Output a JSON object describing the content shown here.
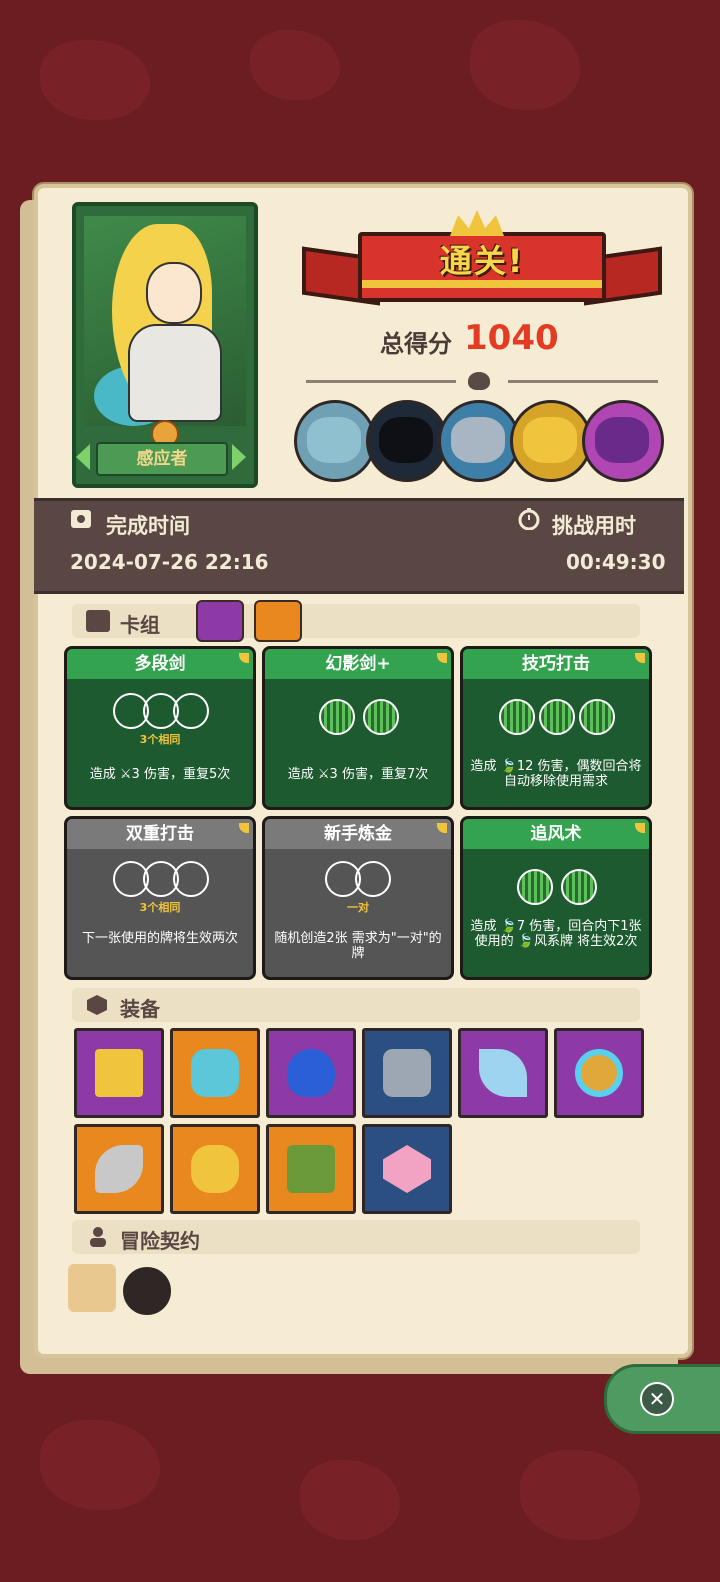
{
  "banner": {
    "title": "通关!"
  },
  "score": {
    "label": "总得分",
    "value": "1040"
  },
  "hero": {
    "name": "感应者"
  },
  "completion": {
    "label": "完成时间",
    "value": "2024-07-26 22:16"
  },
  "duration": {
    "label": "挑战用时",
    "value": "00:49:30"
  },
  "deck": {
    "title": "卡组",
    "cards": [
      {
        "name": "多段剑",
        "color": "green",
        "slots": 3,
        "filled": 0,
        "requirement": "3个相同",
        "desc": "造成 ⚔3 伤害，重复5次"
      },
      {
        "name": "幻影剑+",
        "color": "green",
        "slots": 2,
        "filled": 2,
        "requirement": "",
        "desc": "造成 ⚔3 伤害，重复7次"
      },
      {
        "name": "技巧打击",
        "color": "green",
        "slots": 3,
        "filled": 3,
        "requirement": "",
        "desc": "造成 🍃12 伤害，偶数回合将自动移除使用需求"
      },
      {
        "name": "双重打击",
        "color": "gray",
        "slots": 3,
        "filled": 0,
        "requirement": "3个相同",
        "desc": "下一张使用的牌将生效两次"
      },
      {
        "name": "新手炼金",
        "color": "gray",
        "slots": 2,
        "filled": 0,
        "requirement": "一对",
        "desc": "随机创造2张 需求为\"一对\"的牌"
      },
      {
        "name": "追风术",
        "color": "green",
        "slots": 2,
        "filled": 2,
        "requirement": "",
        "desc": "造成 🍃7 伤害，回合内下1张使用的 🍃风系牌 将生效2次"
      }
    ]
  },
  "equipment": {
    "title": "装备",
    "items": [
      {
        "icon": "gold-bars-icon",
        "bg": "purple"
      },
      {
        "icon": "crystal-shield-icon",
        "bg": "orange"
      },
      {
        "icon": "blue-flame-icon",
        "bg": "purple"
      },
      {
        "icon": "gauntlet-icon",
        "bg": "blue"
      },
      {
        "icon": "blade-hook-icon",
        "bg": "purple"
      },
      {
        "icon": "gem-ring-icon",
        "bg": "purple"
      },
      {
        "icon": "horn-icon",
        "bg": "orange"
      },
      {
        "icon": "golden-mask-icon",
        "bg": "orange"
      },
      {
        "icon": "moss-tablet-icon",
        "bg": "orange"
      },
      {
        "icon": "pink-dice-icon",
        "bg": "blue"
      }
    ]
  },
  "contract": {
    "title": "冒险契约"
  },
  "colors": {
    "accent": "#e23c24",
    "panel": "#f5ecd3",
    "green": "#34a34f",
    "strip": "#5a4744"
  }
}
